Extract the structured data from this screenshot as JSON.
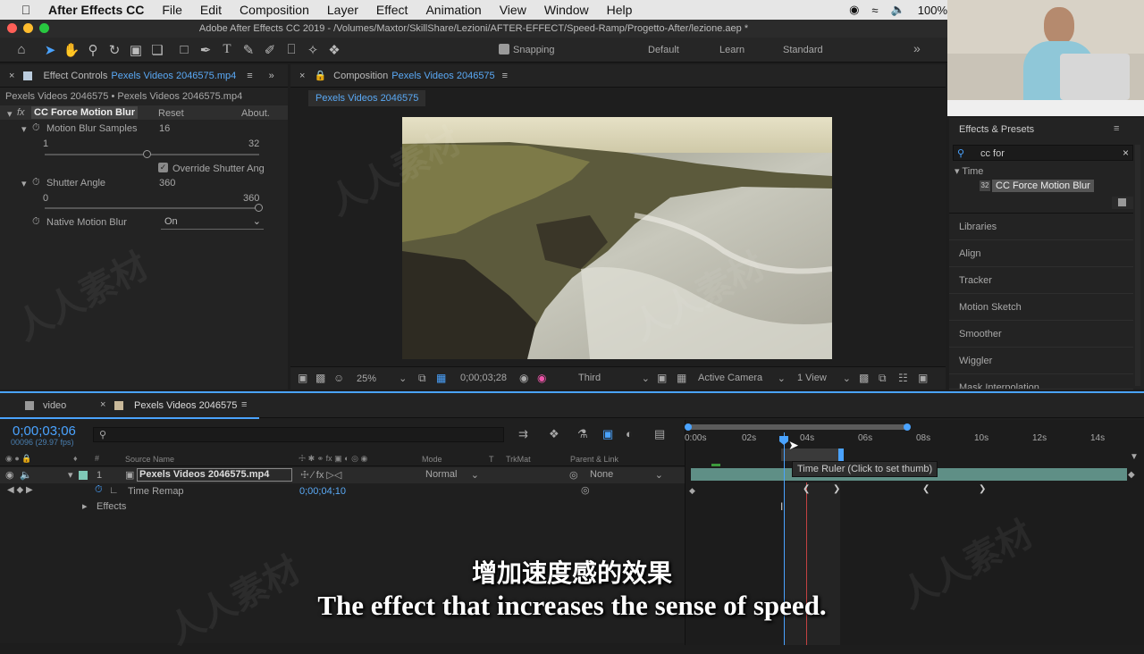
{
  "menubar": {
    "app": "After Effects CC",
    "items": [
      "File",
      "Edit",
      "Composition",
      "Layer",
      "Effect",
      "Animation",
      "View",
      "Window",
      "Help"
    ],
    "battery": "100%"
  },
  "window_title": "Adobe After Effects CC 2019 - /Volumes/Maxtor/SkillShare/Lezioni/AFTER-EFFECT/Speed-Ramp/Progetto-After/lezione.aep *",
  "toolbar": {
    "snapping": "Snapping",
    "workspaces": [
      "Default",
      "Learn",
      "Standard"
    ]
  },
  "effect_controls": {
    "tab_prefix": "Effect Controls",
    "tab_file": "Pexels Videos 2046575.mp4",
    "breadcrumb": "Pexels Videos 2046575 • Pexels Videos 2046575.mp4",
    "effect_name": "CC Force Motion Blur",
    "reset": "Reset",
    "about": "About.",
    "motion_blur_samples": {
      "label": "Motion Blur Samples",
      "value": "16",
      "min": "1",
      "max": "32",
      "level": 0.48
    },
    "override_shutter": "Override Shutter Ang",
    "shutter_angle": {
      "label": "Shutter Angle",
      "value": "360",
      "min": "0",
      "max": "360",
      "level": 1.0
    },
    "native_motion_blur": {
      "label": "Native Motion Blur",
      "value": "On"
    }
  },
  "composition": {
    "tab_prefix": "Composition",
    "tab_name": "Pexels Videos 2046575",
    "sub_tab": "Pexels Videos 2046575",
    "zoom": "25%",
    "timecode": "0;00;03;28",
    "resolution": "Third",
    "camera": "Active Camera",
    "view": "1 View"
  },
  "effects_presets": {
    "title": "Effects & Presets",
    "search": "cc for",
    "category": "Time",
    "result": "CC Force Motion Blur",
    "panels": [
      "Libraries",
      "Align",
      "Tracker",
      "Motion Sketch",
      "Smoother",
      "Wiggler",
      "Mask Interpolation"
    ]
  },
  "timeline": {
    "tab_video": "video",
    "tab_comp": "Pexels Videos 2046575",
    "timecode": "0;00;03;06",
    "frames": "00096 (29.97 fps)",
    "col_source": "Source Name",
    "col_mode": "Mode",
    "col_t": "T",
    "col_trkmat": "TrkMat",
    "col_parent": "Parent & Link",
    "layer_index": "1",
    "layer_name": "Pexels Videos 2046575.mp4",
    "layer_mode": "Normal",
    "layer_parent": "None",
    "time_remap_label": "Time Remap",
    "time_remap_value": "0;00;04;10",
    "effects_label": "Effects",
    "ruler": [
      "0:00s",
      "02s",
      "04s",
      "06s",
      "08s",
      "10s",
      "12s",
      "14s"
    ],
    "tooltip": "Time Ruler (Click to set thumb)"
  },
  "subtitles": {
    "zh": "增加速度感的效果",
    "en": "The effect that increases the sense of speed."
  },
  "colors": {
    "accent": "#4aa3ff",
    "panel": "#232323",
    "track": "#5f8f86"
  }
}
